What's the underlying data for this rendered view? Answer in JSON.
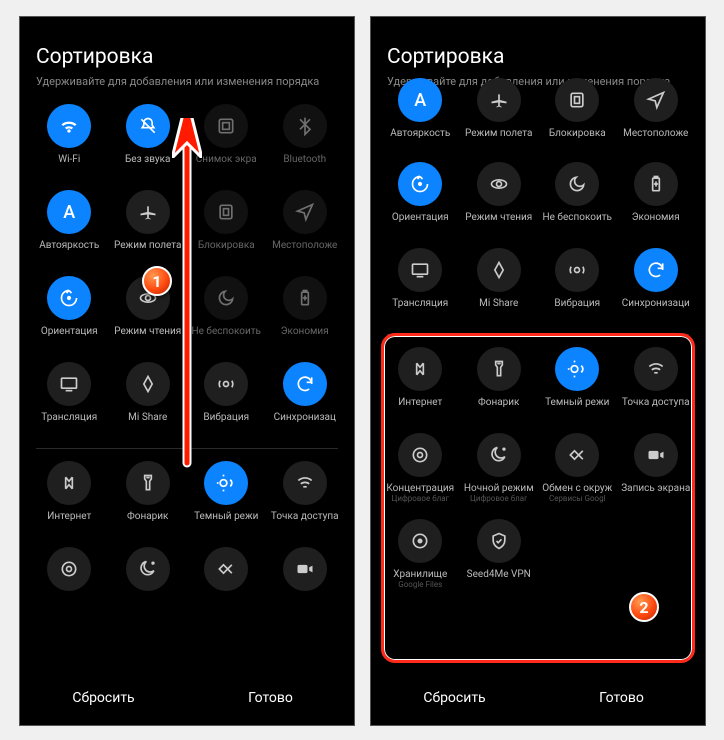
{
  "header": {
    "title": "Сортировка",
    "subtitle": "Удерживайте для добавления или изменения порядка"
  },
  "footer": {
    "reset": "Сбросить",
    "done": "Готово"
  },
  "left": {
    "row1": [
      {
        "icon": "wifi",
        "label": "Wi-Fi",
        "active": true
      },
      {
        "icon": "mute",
        "label": "Без звука",
        "active": true
      },
      {
        "icon": "screenshot",
        "label": "Снимок экра",
        "active": false,
        "dim": true
      },
      {
        "icon": "bluetooth",
        "label": "Bluetooth",
        "active": false,
        "dim": true
      }
    ],
    "row2": [
      {
        "icon": "autobright",
        "label": "Автояркость",
        "active": true
      },
      {
        "icon": "airplane",
        "label": "Режим полета",
        "active": false
      },
      {
        "icon": "lock",
        "label": "Блокировка",
        "active": false,
        "dim": true
      },
      {
        "icon": "location",
        "label": "Местоположе",
        "active": false,
        "dim": true
      }
    ],
    "row3": [
      {
        "icon": "orientation",
        "label": "Ориентация",
        "active": true
      },
      {
        "icon": "reading",
        "label": "Режим чтения",
        "active": false
      },
      {
        "icon": "dnd",
        "label": "Не беспокоить",
        "active": false,
        "dim": true
      },
      {
        "icon": "battery",
        "label": "Экономия",
        "active": false,
        "dim": true
      }
    ],
    "row4": [
      {
        "icon": "cast",
        "label": "Трансляция",
        "active": false
      },
      {
        "icon": "mishare",
        "label": "Mi Share",
        "active": false
      },
      {
        "icon": "vibration",
        "label": "Вибрация",
        "active": false
      },
      {
        "icon": "sync",
        "label": "Синхронизац",
        "active": true
      }
    ],
    "rowB1": [
      {
        "icon": "internet",
        "label": "Интернет",
        "active": false
      },
      {
        "icon": "flashlight",
        "label": "Фонарик",
        "active": false
      },
      {
        "icon": "darkmode",
        "label": "Темный режи",
        "active": true
      },
      {
        "icon": "hotspot",
        "label": "Точка доступа",
        "active": false
      }
    ],
    "rowB2": [
      {
        "icon": "focus",
        "label": "",
        "active": false
      },
      {
        "icon": "night",
        "label": "",
        "active": false
      },
      {
        "icon": "nearby",
        "label": "",
        "active": false
      },
      {
        "icon": "record",
        "label": "",
        "active": false
      }
    ]
  },
  "right": {
    "rowTop": [
      {
        "icon": "autobright",
        "label": "Автояркость",
        "active": true,
        "half": true
      },
      {
        "icon": "airplane",
        "label": "Режим полета",
        "active": false,
        "half": true
      },
      {
        "icon": "lock",
        "label": "Блокировка",
        "active": false,
        "half": true
      },
      {
        "icon": "location",
        "label": "Местоположе",
        "active": false,
        "half": true
      }
    ],
    "row1": [
      {
        "icon": "orientation",
        "label": "Ориентация",
        "active": true
      },
      {
        "icon": "reading",
        "label": "Режим чтения",
        "active": false
      },
      {
        "icon": "dnd",
        "label": "Не беспокоить",
        "active": false
      },
      {
        "icon": "battery",
        "label": "Экономия",
        "active": false
      }
    ],
    "row2": [
      {
        "icon": "cast",
        "label": "Трансляция",
        "active": false
      },
      {
        "icon": "mishare",
        "label": "Mi Share",
        "active": false
      },
      {
        "icon": "vibration",
        "label": "Вибрация",
        "active": false
      },
      {
        "icon": "sync",
        "label": "Синхронизаци",
        "active": true
      }
    ],
    "rowB1": [
      {
        "icon": "internet",
        "label": "Интернет",
        "active": false
      },
      {
        "icon": "flashlight",
        "label": "Фонарик",
        "active": false
      },
      {
        "icon": "darkmode",
        "label": "Темный режи",
        "active": true
      },
      {
        "icon": "hotspot",
        "label": "Точка доступа",
        "active": false
      }
    ],
    "rowB2": [
      {
        "icon": "focus",
        "label": "Концентрация",
        "sub": "Цифровое благ",
        "active": false
      },
      {
        "icon": "night",
        "label": "Ночной режим",
        "sub": "Цифровое благ",
        "active": false
      },
      {
        "icon": "nearby",
        "label": "Обмен с окруж",
        "sub": "Сервисы Googl",
        "active": false
      },
      {
        "icon": "record",
        "label": "Запись экрана",
        "active": false
      }
    ],
    "rowB3": [
      {
        "icon": "storage",
        "label": "Хранилище",
        "sub": "Google Files",
        "active": false
      },
      {
        "icon": "vpn",
        "label": "Seed4Me VPN",
        "active": false
      }
    ]
  },
  "callouts": {
    "c1": "1",
    "c2": "2"
  }
}
